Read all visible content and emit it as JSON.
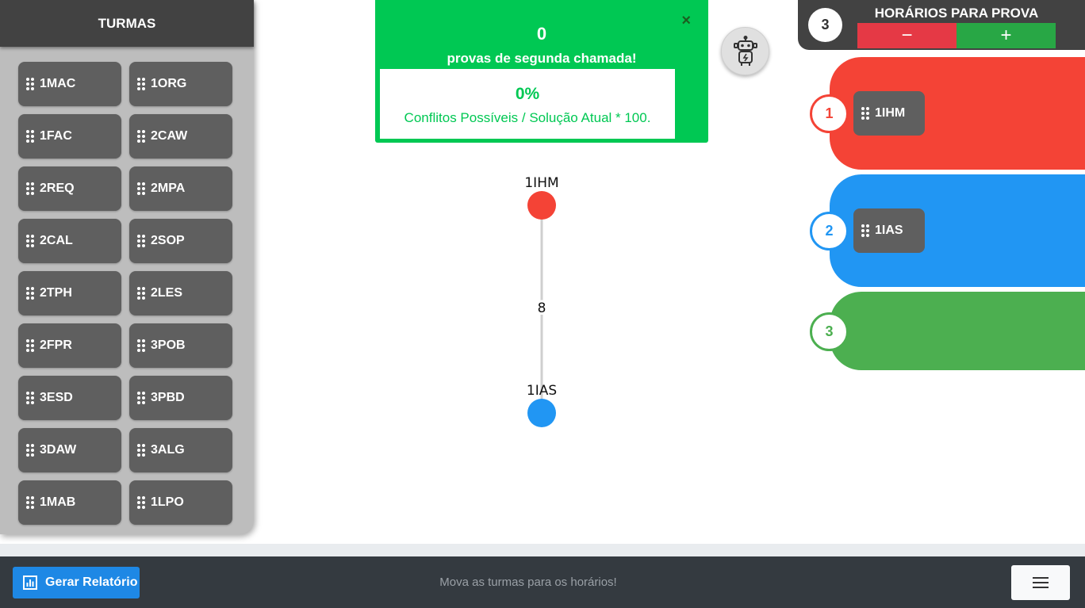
{
  "turmas_panel": {
    "title": "TURMAS",
    "items": [
      {
        "label": "1MAC"
      },
      {
        "label": "1ORG"
      },
      {
        "label": "1FAC"
      },
      {
        "label": "2CAW"
      },
      {
        "label": "2REQ"
      },
      {
        "label": "2MPA"
      },
      {
        "label": "2CAL"
      },
      {
        "label": "2SOP"
      },
      {
        "label": "2TPH"
      },
      {
        "label": "2LES"
      },
      {
        "label": "2FPR"
      },
      {
        "label": "3POB"
      },
      {
        "label": "3ESD"
      },
      {
        "label": "3PBD"
      },
      {
        "label": "3DAW"
      },
      {
        "label": "3ALG"
      },
      {
        "label": "1MAB"
      },
      {
        "label": "1LPO"
      }
    ]
  },
  "stats": {
    "count": "0",
    "count_label": "provas de segunda chamada!",
    "percent": "0%",
    "description": "Conflitos Possíveis / Solução Atual * 100.",
    "close_symbol": "×",
    "color": "#00c853"
  },
  "robot_button": {
    "icon": "robot-icon"
  },
  "graph": {
    "nodes": [
      {
        "label": "1IHM",
        "color": "#f44336"
      },
      {
        "label": "1IAS",
        "color": "#2196f3"
      }
    ],
    "edge_weight": "8"
  },
  "horarios": {
    "title": "HORÁRIOS PARA PROVA",
    "count": "3",
    "minus_symbol": "−",
    "plus_symbol": "+",
    "slots": [
      {
        "number": "1",
        "color": "#f44336",
        "turma": "1IHM"
      },
      {
        "number": "2",
        "color": "#2196f3",
        "turma": "1IAS"
      },
      {
        "number": "3",
        "color": "#4caf50",
        "turma": ""
      }
    ]
  },
  "footer": {
    "report_button_label": "Gerar Relatório",
    "hint": "Mova as turmas para os horários!",
    "menu_icon": "hamburger-menu-icon"
  }
}
